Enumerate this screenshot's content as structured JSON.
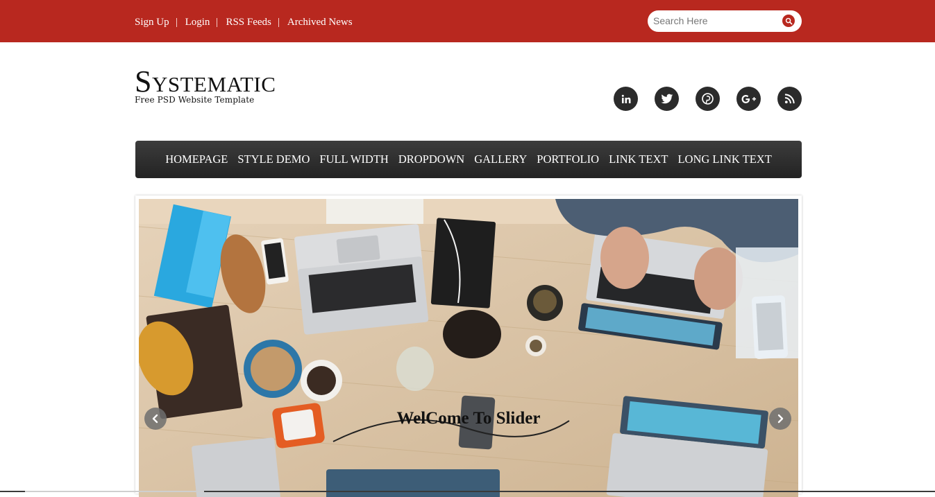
{
  "topbar": {
    "links": [
      "Sign Up",
      "Login",
      "RSS Feeds",
      "Archived News"
    ],
    "search_placeholder": "Search Here",
    "search_icon": "search-icon"
  },
  "brand": {
    "title": "Systematic",
    "tagline": "Free PSD Website Template"
  },
  "social": [
    "linkedin-icon",
    "twitter-icon",
    "pinterest-icon",
    "google-plus-icon",
    "rss-icon"
  ],
  "nav": [
    "HOMEPAGE",
    "STYLE DEMO",
    "FULL WIDTH",
    "DROPDOWN",
    "GALLERY",
    "PORTFOLIO",
    "LINK TEXT",
    "LONG LINK TEXT"
  ],
  "slider": {
    "caption": "WelCome To Slider",
    "prev_icon": "chevron-left-icon",
    "next_icon": "chevron-right-icon"
  },
  "colors": {
    "accent": "#b8281f",
    "nav_bg": "#2f2f2f",
    "social_bg": "#2b2b2b"
  }
}
